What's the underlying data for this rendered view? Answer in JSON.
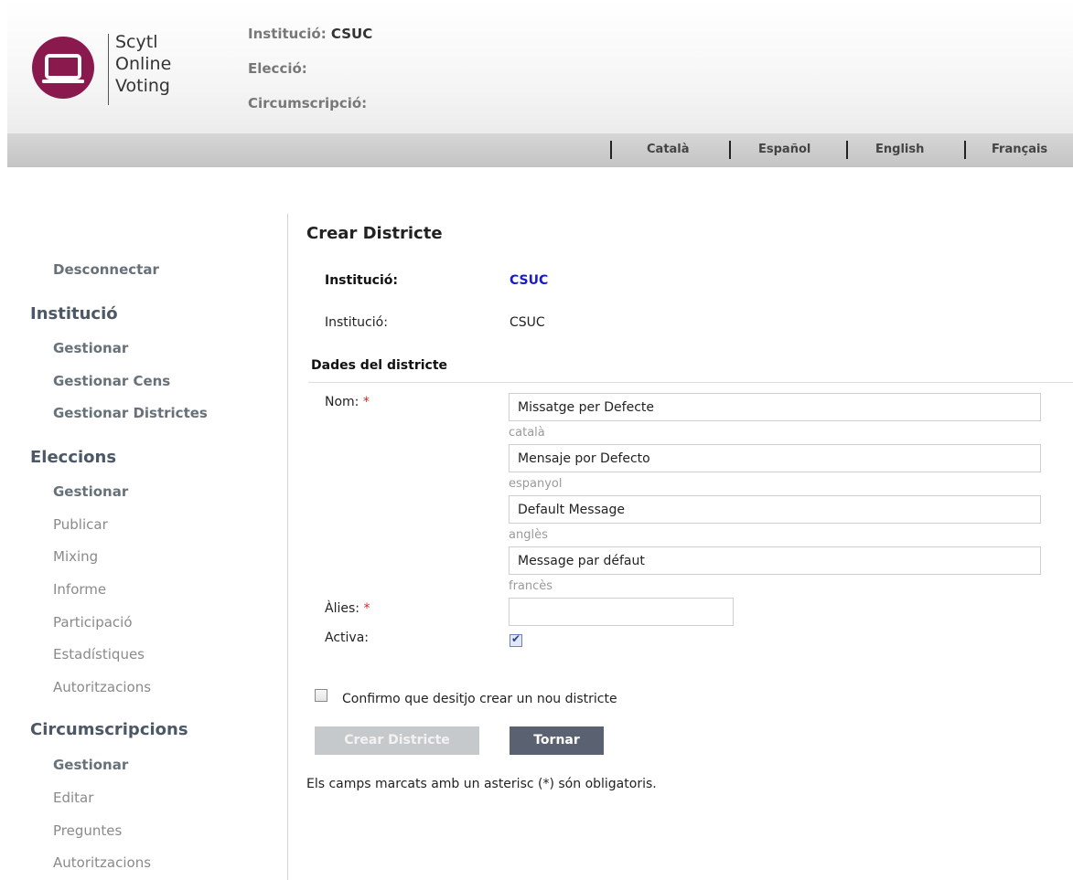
{
  "logo": {
    "line1": "Scytl",
    "line2": "Online",
    "line3": "Voting",
    "brand_color": "#8a1a4e",
    "icon": "laptop-icon"
  },
  "header": {
    "institucio_label": "Institució:",
    "institucio_value": "CSUC",
    "eleccio_label": "Elecció:",
    "circumscripcio_label": "Circumscripció:"
  },
  "languages": [
    "Català",
    "Español",
    "English",
    "Français"
  ],
  "sidebar": {
    "logout": "Desconnectar",
    "sections": [
      {
        "title": "Institució",
        "items": [
          {
            "label": "Gestionar",
            "bold": true
          },
          {
            "label": "Gestionar Cens",
            "bold": true
          },
          {
            "label": "Gestionar Districtes",
            "bold": true
          }
        ]
      },
      {
        "title": "Eleccions",
        "items": [
          {
            "label": "Gestionar",
            "bold": true
          },
          {
            "label": "Publicar",
            "bold": false
          },
          {
            "label": "Mixing",
            "bold": false
          },
          {
            "label": "Informe",
            "bold": false
          },
          {
            "label": "Participació",
            "bold": false
          },
          {
            "label": "Estadístiques",
            "bold": false
          },
          {
            "label": "Autoritzacions",
            "bold": false
          }
        ]
      },
      {
        "title": "Circumscripcions",
        "items": [
          {
            "label": "Gestionar",
            "bold": true
          },
          {
            "label": "Editar",
            "bold": false
          },
          {
            "label": "Preguntes",
            "bold": false
          },
          {
            "label": "Autoritzacions",
            "bold": false
          }
        ]
      }
    ]
  },
  "main": {
    "title": "Crear Districte",
    "institucio_label_bold": "Institució:",
    "institucio_link": "CSUC",
    "institucio_label": "Institució:",
    "institucio_value": "CSUC",
    "section_title": "Dades del districte",
    "nom_label": "Nom:",
    "required_mark": "*",
    "nom_fields": [
      {
        "value": "Missatge per Defecte",
        "lang": "català"
      },
      {
        "value": "Mensaje por Defecto",
        "lang": "espanyol"
      },
      {
        "value": "Default Message",
        "lang": "anglès"
      },
      {
        "value": "Message par défaut",
        "lang": "francès"
      }
    ],
    "alies_label": "Àlies:",
    "alies_value": "",
    "activa_label": "Activa:",
    "activa_checked": true,
    "confirm_label": "Confirmo que desitjo crear un nou districte",
    "confirm_checked": false,
    "create_button": "Crear Districte",
    "back_button": "Tornar",
    "footnote": "Els camps marcats amb un asterisc (*) són obligatoris."
  }
}
